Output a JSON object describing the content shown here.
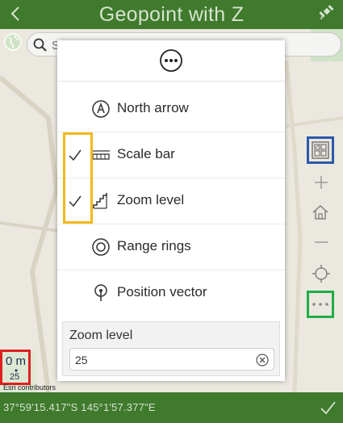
{
  "header": {
    "title": "Geopoint with Z"
  },
  "search": {
    "placeholder": "Search"
  },
  "menu": {
    "items": [
      {
        "label": "North arrow",
        "icon": "north-arrow-icon",
        "checked": false
      },
      {
        "label": "Scale bar",
        "icon": "scale-bar-icon",
        "checked": true
      },
      {
        "label": "Zoom level",
        "icon": "zoom-level-icon",
        "checked": true
      },
      {
        "label": "Range rings",
        "icon": "range-rings-icon",
        "checked": false
      },
      {
        "label": "Position vector",
        "icon": "position-vector-icon",
        "checked": false
      }
    ],
    "zoom_panel": {
      "label": "Zoom level",
      "value": "25"
    }
  },
  "scale": {
    "distance": "0 m",
    "zoom": "25"
  },
  "attribution": "Esri contributors",
  "footer": {
    "coordinates": "37°59'15.417\"S 145°1'57.377\"E"
  },
  "colors": {
    "header_bg": "#3f7a2d",
    "basemap_highlight": "#2a5aa8",
    "more_highlight": "#1fae45",
    "checkbox_highlight": "#f3b81b",
    "scale_highlight": "#e02020"
  }
}
